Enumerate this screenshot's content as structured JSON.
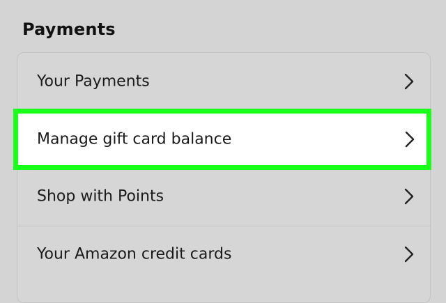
{
  "section": {
    "title": "Payments"
  },
  "menu": {
    "items": [
      {
        "label": "Your Payments",
        "icon": "chevron-right-icon"
      },
      {
        "label": "Manage gift card balance",
        "icon": "chevron-right-icon",
        "highlighted": true
      },
      {
        "label": "Shop with Points",
        "icon": "chevron-right-icon"
      },
      {
        "label": "Your Amazon credit cards",
        "icon": "chevron-right-icon"
      }
    ]
  },
  "colors": {
    "background": "#d4d4d4",
    "highlight_border": "#1aff1a",
    "highlight_fill": "#ffffff",
    "text": "#1a1a1a"
  }
}
